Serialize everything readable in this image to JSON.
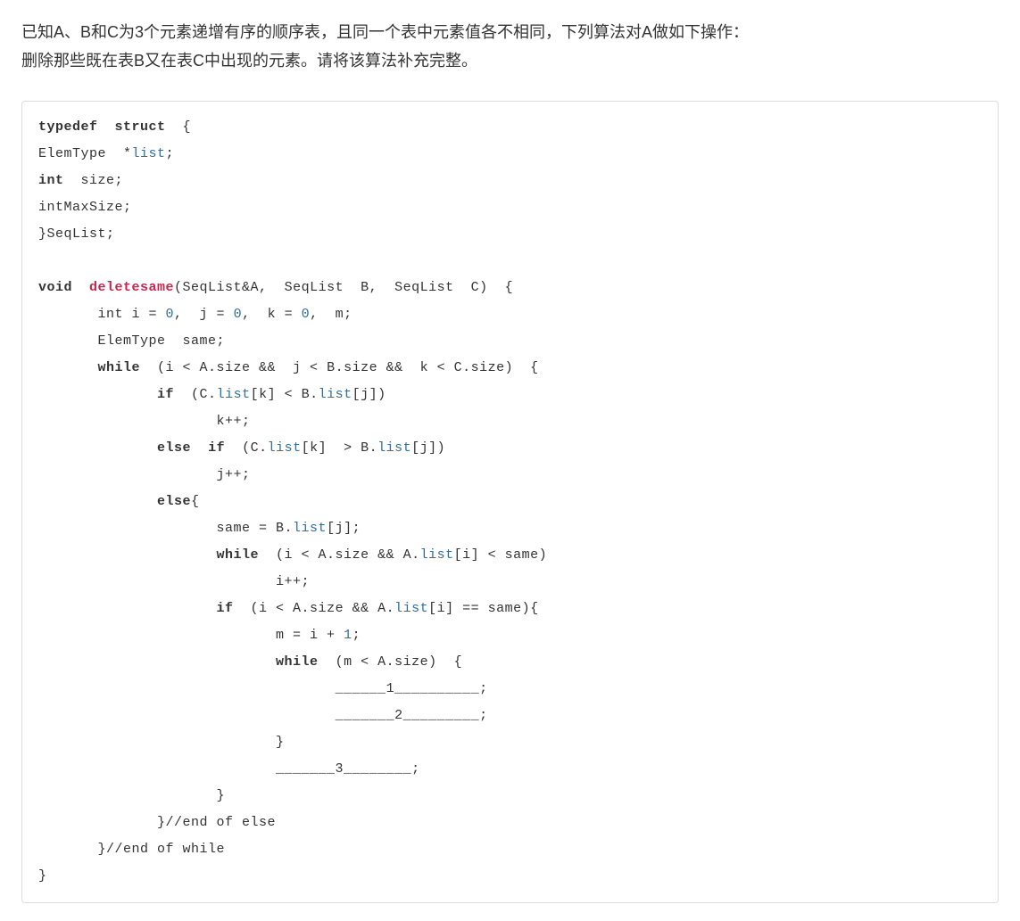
{
  "question": {
    "line1": "已知A、B和C为3个元素递增有序的顺序表，且同一个表中元素值各不相同，下列算法对A做如下操作：",
    "line2": "删除那些既在表B又在表C中出现的元素。请将该算法补充完整。"
  },
  "code": {
    "kw_typedef": "typedef",
    "kw_struct": "struct",
    "kw_int": "int",
    "kw_void": "void",
    "kw_while": "while",
    "kw_if": "if",
    "kw_else": "else",
    "fn_deletesame": "deletesame",
    "id_list": "list",
    "id_ElemType": "ElemType",
    "id_size": "size",
    "id_intMaxSize": "intMaxSize",
    "id_SeqList": "SeqList",
    "num_0": "0",
    "num_1": "1",
    "blank1": "______1__________",
    "blank2": "_______2_________",
    "blank3": "_______3________",
    "comment_else": "//end of else",
    "comment_while": "//end of while"
  }
}
